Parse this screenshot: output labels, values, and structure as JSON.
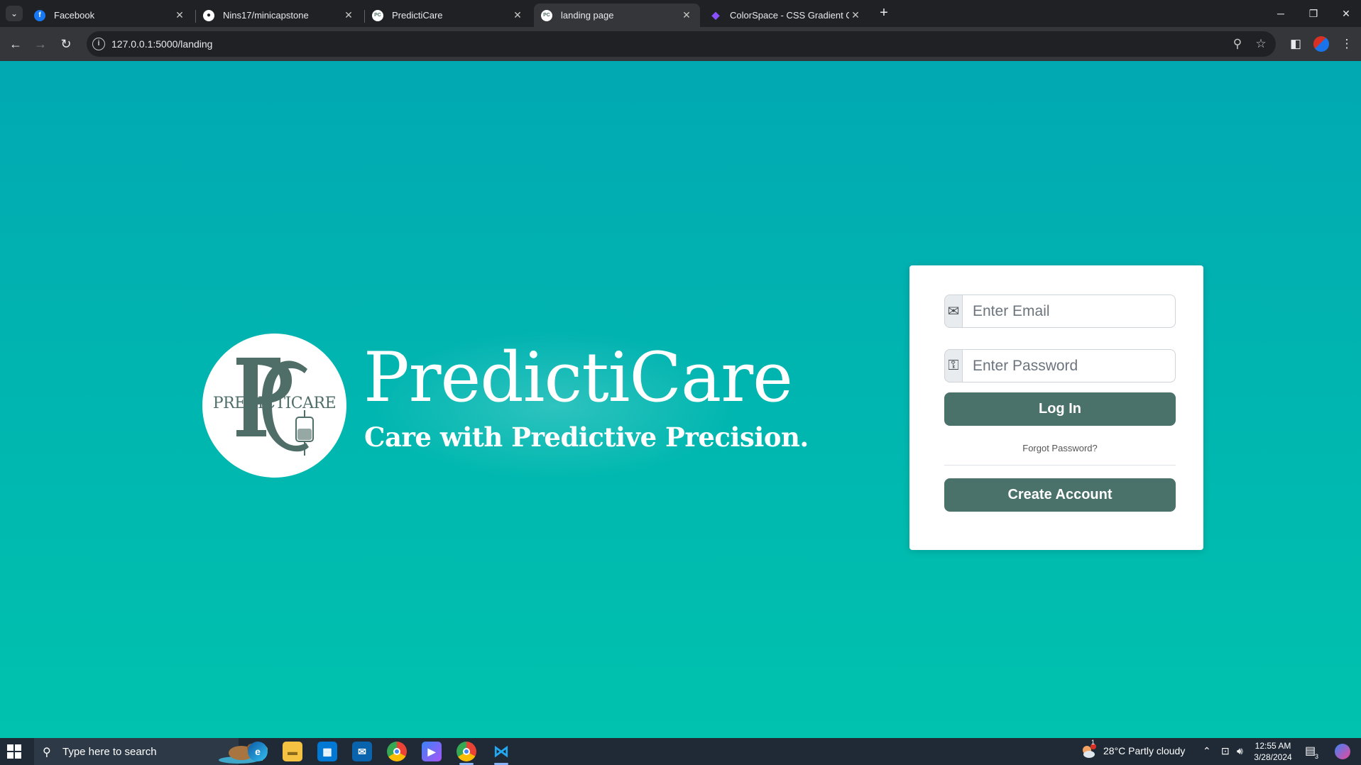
{
  "browser": {
    "tabs": [
      {
        "title": "Facebook",
        "icon": "facebook-icon",
        "color": "#1877f2"
      },
      {
        "title": "Nins17/minicapstone",
        "icon": "github-icon",
        "color": "#ffffff"
      },
      {
        "title": "PredictiCare",
        "icon": "predicticare-icon",
        "color": "#ffffff"
      },
      {
        "title": "landing page",
        "icon": "predicticare-icon",
        "color": "#ffffff",
        "active": true
      },
      {
        "title": "ColorSpace - CSS Gradient Color",
        "icon": "colorspace-icon",
        "color": "#8a4fff"
      }
    ],
    "tab_close": "✕",
    "new_tab": "+",
    "url": "127.0.0.1:5000/landing"
  },
  "brand": {
    "logo_letters": "PC",
    "logo_wordmark": "PREDICTICARE",
    "title": "PredictiCare",
    "tagline": "Care with Predictive Precision."
  },
  "login": {
    "email_placeholder": "Enter Email",
    "password_placeholder": "Enter Password",
    "login_label": "Log In",
    "forgot_label": "Forgot Password?",
    "create_label": "Create Account"
  },
  "colors": {
    "page_top": "#01a9b2",
    "page_bottom": "#00c2ae",
    "button": "#4b716b",
    "logo": "#4f6e68"
  },
  "taskbar": {
    "search_placeholder": "Type here to search",
    "apps": [
      "edge-icon",
      "file-explorer-icon",
      "store-icon",
      "mail-icon",
      "chrome-icon",
      "copilot-icon",
      "chrome-profile-icon",
      "vscode-icon"
    ],
    "weather": "28°C  Partly cloudy",
    "weather_badge": "1",
    "time": "12:55 AM",
    "date": "3/28/2024",
    "notification_count": "3"
  }
}
